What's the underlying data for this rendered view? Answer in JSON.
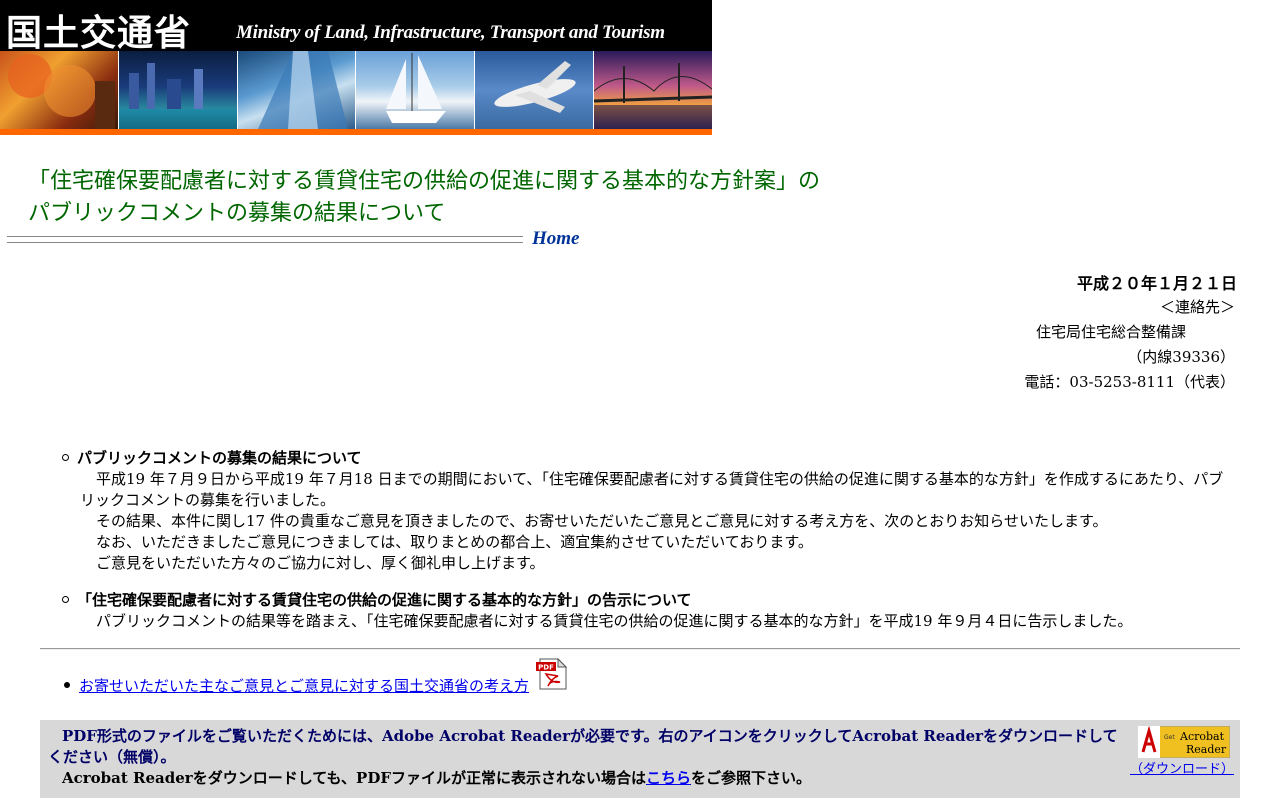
{
  "banner": {
    "kanji": "国土交通省",
    "english": "Ministry of Land, Infrastructure, Transport and Tourism"
  },
  "title": {
    "line1": "「住宅確保要配慮者に対する賃貸住宅の供給の促進に関する基本的な方針案」の",
    "line2": "パブリックコメントの募集の結果について"
  },
  "nav": {
    "home": "Home"
  },
  "header_info": {
    "date": "平成２０年１月２１日",
    "contact_label": "＜連絡先＞",
    "department": "住宅局住宅総合整備課",
    "extension": "（内線39336）",
    "phone": "電話：03-5253-8111（代表）"
  },
  "sections": [
    {
      "heading": "パブリックコメントの募集の結果について",
      "paragraphs": [
        "平成19 年７月９日から平成19 年７月18 日までの期間において、「住宅確保要配慮者に対する賃貸住宅の供給の促進に関する基本的な方針」を作成するにあたり、パブリックコメントの募集を行いました。",
        "その結果、本件に関し17 件の貴重なご意見を頂きましたので、お寄せいただいたご意見とご意見に対する考え方を、次のとおりお知らせいたします。",
        "なお、いただきましたご意見につきましては、取りまとめの都合上、適宜集約させていただいております。",
        "ご意見をいただいた方々のご協力に対し、厚く御礼申し上げます。"
      ]
    },
    {
      "heading": "「住宅確保要配慮者に対する賃貸住宅の供給の促進に関する基本的な方針」の告示について",
      "paragraphs": [
        "パブリックコメントの結果等を踏まえ、「住宅確保要配慮者に対する賃貸住宅の供給の促進に関する基本的な方針」を平成19 年９月４日に告示しました。"
      ]
    }
  ],
  "links": [
    {
      "label": "お寄せいただいた主なご意見とご意見に対する国土交通省の考え方",
      "icon": "pdf-icon"
    }
  ],
  "notice": {
    "line1": "PDF形式のファイルをご覧いただくためには、Adobe Acrobat Readerが必要です。右のアイコンをクリックしてAcrobat Readerをダウンロードしてください（無償）。",
    "line2_pre": "Acrobat Readerをダウンロードしても、PDFファイルが正常に表示されない場合は",
    "line2_link": "こちら",
    "line2_post": "をご参照下さい。",
    "download_label": "（ダウンロード）"
  }
}
